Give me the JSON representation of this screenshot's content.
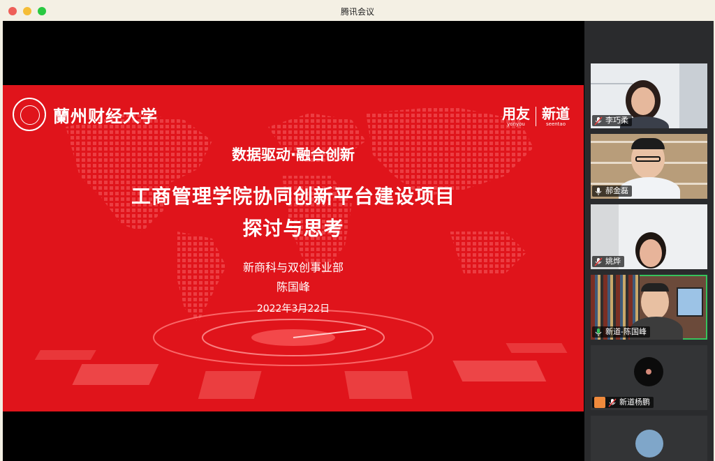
{
  "window": {
    "title": "腾讯会议"
  },
  "slide": {
    "university_logo": "蘭州财经大学",
    "brand_left": "用友",
    "brand_left_en": "yonyou",
    "brand_right": "新道",
    "brand_right_en": "seentao",
    "subtitle": "数据驱动·融合创新",
    "title_line1": "工商管理学院协同创新平台建设项目",
    "title_line2": "探讨与思考",
    "department": "新商科与双创事业部",
    "author": "陈国峰",
    "date": "2022年3月22日"
  },
  "participants": [
    {
      "name": "李巧柔",
      "mic": "muted"
    },
    {
      "name": "郝金磊",
      "mic": "on"
    },
    {
      "name": "姚烨",
      "mic": "muted"
    },
    {
      "name": "新道-陈国峰",
      "mic": "speaking"
    },
    {
      "name": "新道杨鹏",
      "mic": "muted"
    }
  ],
  "colors": {
    "slide_red": "#e0141b",
    "speaking_green": "#36c35c",
    "sidebar_bg": "#2a2b2d"
  }
}
